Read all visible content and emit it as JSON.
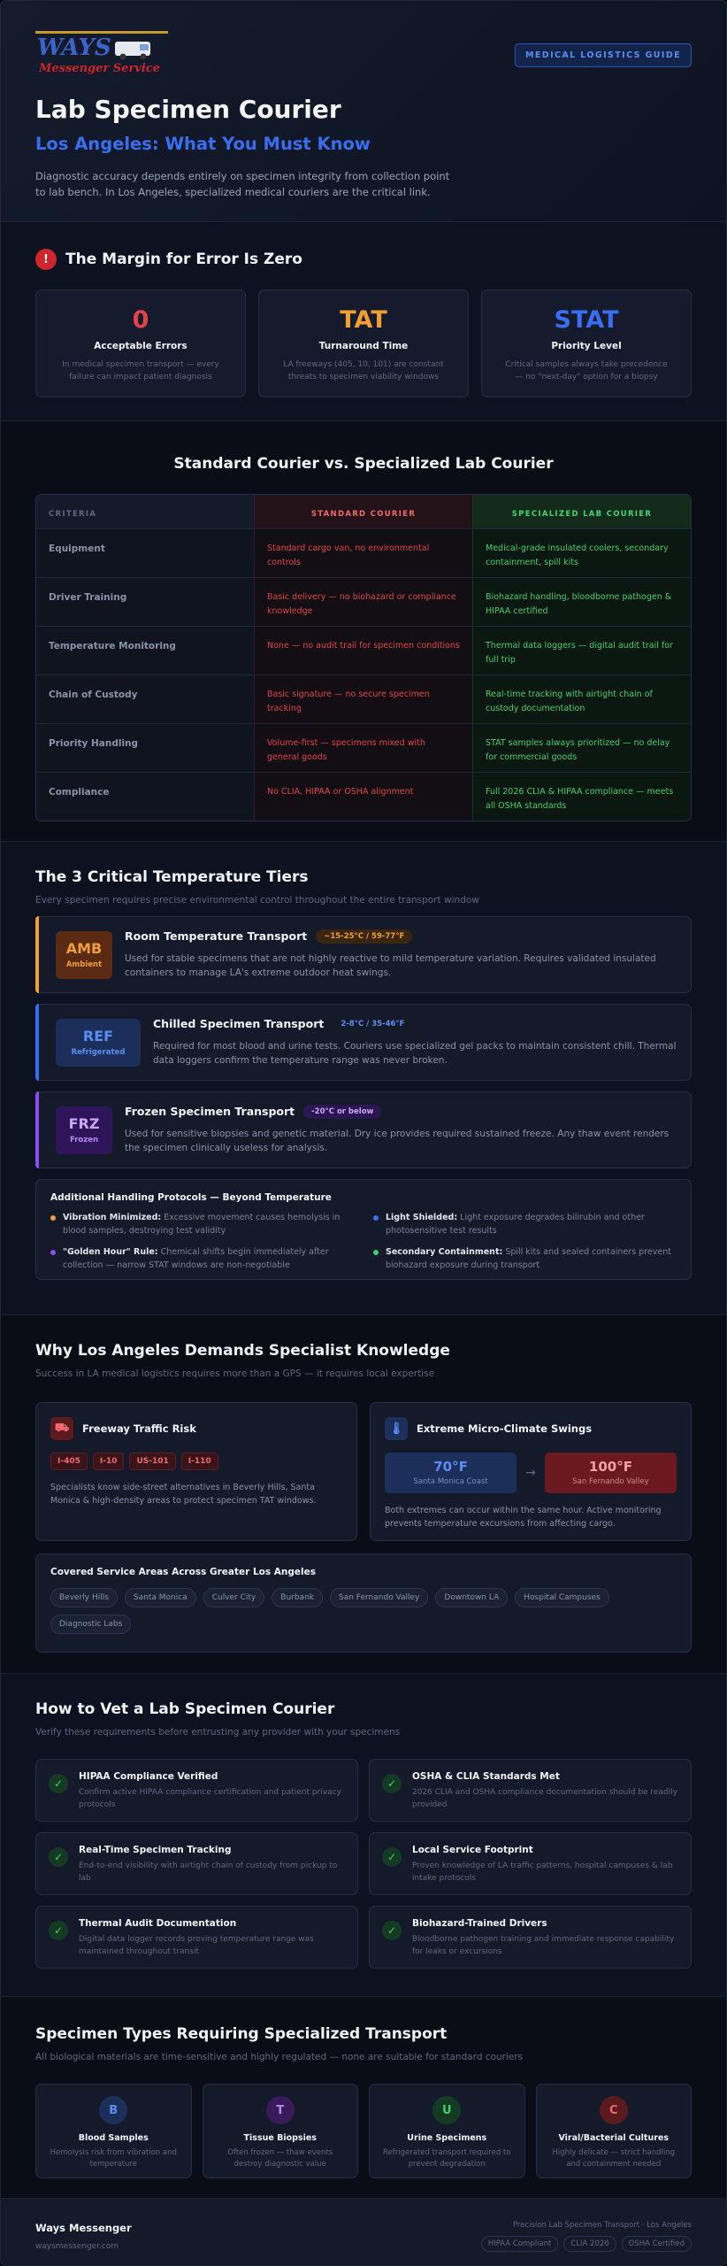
{
  "brand": {
    "logo_word": "WAYS",
    "logo_sub": "Messenger Service",
    "guide_badge": "MEDICAL LOGISTICS GUIDE"
  },
  "hero": {
    "title": "Lab Specimen Courier",
    "subtitle": "Los Angeles: What You Must Know",
    "intro": "Diagnostic accuracy depends entirely on specimen integrity from collection point to lab bench. In Los Angeles, specialized medical couriers are the critical link."
  },
  "margin": {
    "icon": "!",
    "title": "The Margin for Error Is Zero",
    "stats": [
      {
        "value": "0",
        "label": "Acceptable Errors",
        "desc": "In medical specimen transport — every failure can impact patient diagnosis",
        "color": "#e0444a"
      },
      {
        "value": "TAT",
        "label": "Turnaround Time",
        "desc": "LA freeways (405, 10, 101) are constant threats to specimen viability windows",
        "color": "#f0a033"
      },
      {
        "value": "STAT",
        "label": "Priority Level",
        "desc": "Critical samples always take precedence — no \"next-day\" option for a biopsy",
        "color": "#3a6ef0"
      }
    ]
  },
  "comparison": {
    "title": "Standard Courier vs. Specialized Lab Courier",
    "headers": [
      "CRITERIA",
      "STANDARD COURIER",
      "SPECIALIZED LAB COURIER"
    ],
    "rows": [
      [
        "Equipment",
        "Standard cargo van, no environmental controls",
        "Medical-grade insulated coolers, secondary containment, spill kits"
      ],
      [
        "Driver Training",
        "Basic delivery — no biohazard or compliance knowledge",
        "Biohazard handling, bloodborne pathogen & HIPAA certified"
      ],
      [
        "Temperature Monitoring",
        "None — no audit trail for specimen conditions",
        "Thermal data loggers — digital audit trail for full trip"
      ],
      [
        "Chain of Custody",
        "Basic signature — no secure specimen tracking",
        "Real-time tracking with airtight chain of custody documentation"
      ],
      [
        "Priority Handling",
        "Volume-first — specimens mixed with general goods",
        "STAT samples always prioritized — no delay for commercial goods"
      ],
      [
        "Compliance",
        "No CLIA, HIPAA or OSHA alignment",
        "Full 2026 CLIA & HIPAA compliance — meets all OSHA standards"
      ]
    ]
  },
  "temperature": {
    "title": "The 3 Critical Temperature Tiers",
    "subtitle": "Every specimen requires precise environmental control throughout the entire transport window",
    "tiers": [
      {
        "code": "AMB",
        "code_label": "Ambient",
        "title": "Room Temperature Transport",
        "range": "~15-25°C / 59-77°F",
        "desc": "Used for stable specimens that are not highly reactive to mild temperature variation. Requires validated insulated containers to manage LA's extreme outdoor heat swings.",
        "accent": "#f0a033"
      },
      {
        "code": "REF",
        "code_label": "Refrigerated",
        "title": "Chilled Specimen Transport",
        "range": "2-8°C / 35-46°F",
        "desc": "Required for most blood and urine tests. Couriers use specialized gel packs to maintain consistent chill. Thermal data loggers confirm the temperature range was never broken.",
        "accent": "#3a6ef0"
      },
      {
        "code": "FRZ",
        "code_label": "Frozen",
        "title": "Frozen Specimen Transport",
        "range": "-20°C or below",
        "desc": "Used for sensitive biopsies and genetic material. Dry ice provides required sustained freeze. Any thaw event renders the specimen clinically useless for analysis.",
        "accent": "#8a4ef0"
      }
    ],
    "protocols": {
      "title": "Additional Handling Protocols — Beyond Temperature",
      "items": [
        {
          "bold": "Vibration Minimized:",
          "text": "Excessive movement causes hemolysis in blood samples, destroying test validity",
          "color": "#f0a033"
        },
        {
          "bold": "Light Shielded:",
          "text": "Light exposure degrades bilirubin and other photosensitive test results",
          "color": "#3a6ef0"
        },
        {
          "bold": "\"Golden Hour\" Rule:",
          "text": "Chemical shifts begin immediately after collection — narrow STAT windows are non-negotiable",
          "color": "#8a4ef0"
        },
        {
          "bold": "Secondary Containment:",
          "text": "Spill kits and sealed containers prevent biohazard exposure during transport",
          "color": "#3fd072"
        }
      ]
    }
  },
  "la": {
    "title": "Why Los Angeles Demands Specialist Knowledge",
    "subtitle": "Success in LA medical logistics requires more than a GPS — it requires local expertise",
    "traffic": {
      "title": "Freeway Traffic Risk",
      "freeways": [
        "I-405",
        "I-10",
        "US-101",
        "I-110"
      ],
      "text": "Specialists know side-street alternatives in Beverly Hills, Santa Monica & high-density areas to protect specimen TAT windows."
    },
    "climate": {
      "title": "Extreme Micro-Climate Swings",
      "cool_temp": "70°F",
      "cool_place": "Santa Monica Coast",
      "hot_temp": "100°F",
      "hot_place": "San Fernando Valley",
      "text": "Both extremes can occur within the same hour. Active monitoring prevents temperature excursions from affecting cargo."
    },
    "areas": {
      "title": "Covered Service Areas Across Greater Los Angeles",
      "list": [
        "Beverly Hills",
        "Santa Monica",
        "Culver City",
        "Burbank",
        "San Fernando Valley",
        "Downtown LA",
        "Hospital Campuses",
        "Diagnostic Labs"
      ]
    }
  },
  "vet": {
    "title": "How to Vet a Lab Specimen Courier",
    "subtitle": "Verify these requirements before entrusting any provider with your specimens",
    "items": [
      {
        "title": "HIPAA Compliance Verified",
        "desc": "Confirm active HIPAA compliance certification and patient privacy protocols"
      },
      {
        "title": "OSHA & CLIA Standards Met",
        "desc": "2026 CLIA and OSHA compliance documentation should be readily provided"
      },
      {
        "title": "Real-Time Specimen Tracking",
        "desc": "End-to-end visibility with airtight chain of custody from pickup to lab"
      },
      {
        "title": "Local Service Footprint",
        "desc": "Proven knowledge of LA traffic patterns, hospital campuses & lab intake protocols"
      },
      {
        "title": "Thermal Audit Documentation",
        "desc": "Digital data logger records proving temperature range was maintained throughout transit"
      },
      {
        "title": "Biohazard-Trained Drivers",
        "desc": "Bloodborne pathogen training and immediate response capability for leaks or excursions"
      }
    ]
  },
  "types": {
    "title": "Specimen Types Requiring Specialized Transport",
    "subtitle": "All biological materials are time-sensitive and highly regulated — none are suitable for standard couriers",
    "items": [
      {
        "letter": "B",
        "title": "Blood Samples",
        "desc": "Hemolysis risk from vibration and temperature",
        "bg": "#1b2f5a",
        "fg": "#5d8df2"
      },
      {
        "letter": "T",
        "title": "Tissue Biopsies",
        "desc": "Often frozen — thaw events destroy diagnostic value",
        "bg": "#3a1a5a",
        "fg": "#b68af5"
      },
      {
        "letter": "U",
        "title": "Urine Specimens",
        "desc": "Refrigerated transport required to prevent degradation",
        "bg": "#153a24",
        "fg": "#3fd072"
      },
      {
        "letter": "C",
        "title": "Viral/Bacterial Cultures",
        "desc": "Highly delicate — strict handling and containment needed",
        "bg": "#5a1a1e",
        "fg": "#f06a6f"
      }
    ]
  },
  "footer": {
    "name": "Ways Messenger",
    "url": "waysmessenger.com",
    "tagline": "Precision Lab Specimen Transport · Los Angeles",
    "badges": [
      "HIPAA Compliant",
      "CLIA 2026",
      "OSHA Certified"
    ]
  }
}
